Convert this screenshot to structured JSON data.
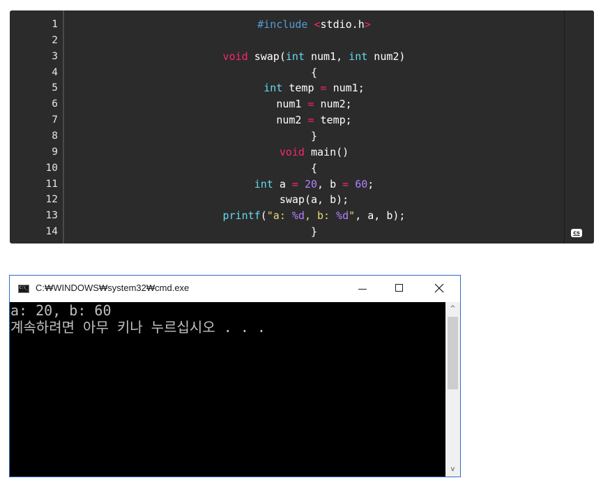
{
  "code": {
    "lines": [
      {
        "n": "1",
        "tokens": [
          {
            "t": "#include ",
            "c": "#569cd6"
          },
          {
            "t": "<",
            "c": "#f92672"
          },
          {
            "t": "stdio.h",
            "c": "#ffffff"
          },
          {
            "t": ">",
            "c": "#f92672"
          }
        ]
      },
      {
        "n": "2",
        "tokens": []
      },
      {
        "n": "3",
        "tokens": [
          {
            "t": "void",
            "c": "#f92672"
          },
          {
            "t": " swap(",
            "c": "#ffffff"
          },
          {
            "t": "int",
            "c": "#66d9ef"
          },
          {
            "t": " num1, ",
            "c": "#ffffff"
          },
          {
            "t": "int",
            "c": "#66d9ef"
          },
          {
            "t": " num2)",
            "c": "#ffffff"
          }
        ]
      },
      {
        "n": "4",
        "tokens": [
          {
            "t": "{",
            "c": "#ffffff"
          }
        ]
      },
      {
        "n": "5",
        "tokens": [
          {
            "t": "int",
            "c": "#66d9ef"
          },
          {
            "t": " temp ",
            "c": "#ffffff"
          },
          {
            "t": "=",
            "c": "#f92672"
          },
          {
            "t": " num1;",
            "c": "#ffffff"
          }
        ]
      },
      {
        "n": "6",
        "tokens": [
          {
            "t": "num1 ",
            "c": "#ffffff"
          },
          {
            "t": "=",
            "c": "#f92672"
          },
          {
            "t": " num2;",
            "c": "#ffffff"
          }
        ]
      },
      {
        "n": "7",
        "tokens": [
          {
            "t": "num2 ",
            "c": "#ffffff"
          },
          {
            "t": "=",
            "c": "#f92672"
          },
          {
            "t": " temp;",
            "c": "#ffffff"
          }
        ]
      },
      {
        "n": "8",
        "tokens": [
          {
            "t": "}",
            "c": "#ffffff"
          }
        ]
      },
      {
        "n": "9",
        "tokens": [
          {
            "t": "void",
            "c": "#f92672"
          },
          {
            "t": " main()",
            "c": "#ffffff"
          }
        ]
      },
      {
        "n": "10",
        "tokens": [
          {
            "t": "{",
            "c": "#ffffff"
          }
        ]
      },
      {
        "n": "11",
        "tokens": [
          {
            "t": "int",
            "c": "#66d9ef"
          },
          {
            "t": " a ",
            "c": "#ffffff"
          },
          {
            "t": "=",
            "c": "#f92672"
          },
          {
            "t": " ",
            "c": "#ffffff"
          },
          {
            "t": "20",
            "c": "#ae81ff"
          },
          {
            "t": ", b ",
            "c": "#ffffff"
          },
          {
            "t": "=",
            "c": "#f92672"
          },
          {
            "t": " ",
            "c": "#ffffff"
          },
          {
            "t": "60",
            "c": "#ae81ff"
          },
          {
            "t": ";",
            "c": "#ffffff"
          }
        ]
      },
      {
        "n": "12",
        "tokens": [
          {
            "t": "swap(a, b);",
            "c": "#ffffff"
          }
        ]
      },
      {
        "n": "13",
        "tokens": [
          {
            "t": "printf",
            "c": "#66d9ef"
          },
          {
            "t": "(",
            "c": "#ffffff"
          },
          {
            "t": "\"a: ",
            "c": "#e6db74"
          },
          {
            "t": "%d",
            "c": "#ae81ff"
          },
          {
            "t": ", b: ",
            "c": "#e6db74"
          },
          {
            "t": "%d",
            "c": "#ae81ff"
          },
          {
            "t": "\"",
            "c": "#e6db74"
          },
          {
            "t": ", a, b);",
            "c": "#ffffff"
          }
        ]
      },
      {
        "n": "14",
        "tokens": [
          {
            "t": "}",
            "c": "#ffffff"
          }
        ]
      }
    ],
    "badge_label": "cs"
  },
  "console": {
    "title": "C:₩WINDOWS₩system32₩cmd.exe",
    "icon_label": "C:\\_",
    "output": [
      "a: 20, b: 60",
      "계속하려면 아무 키나 누르십시오 . . ."
    ],
    "scroll_up": "^",
    "scroll_down": "v"
  }
}
